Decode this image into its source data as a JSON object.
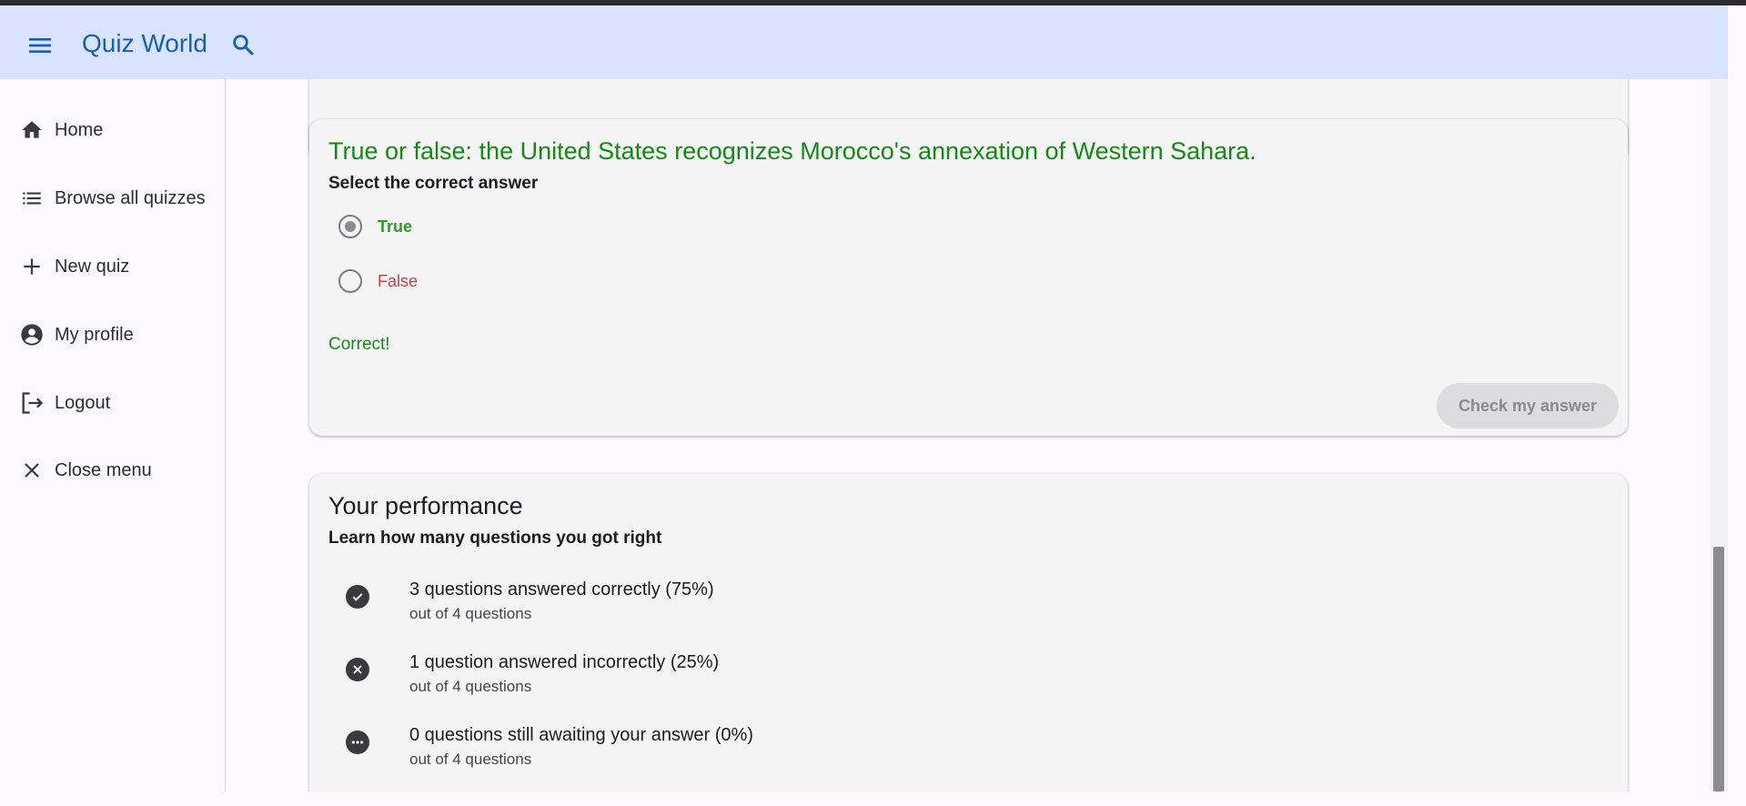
{
  "app": {
    "title": "Quiz World"
  },
  "sidebar": {
    "items": [
      {
        "label": "Home",
        "icon": "home-icon"
      },
      {
        "label": "Browse all quizzes",
        "icon": "list-icon"
      },
      {
        "label": "New quiz",
        "icon": "plus-icon"
      },
      {
        "label": "My profile",
        "icon": "account-circle-icon"
      },
      {
        "label": "Logout",
        "icon": "logout-icon"
      },
      {
        "label": "Close menu",
        "icon": "close-icon"
      }
    ]
  },
  "question": {
    "title": "True or false: the United States recognizes Morocco's annexation of Western Sahara.",
    "subtitle": "Select the correct answer",
    "options": [
      {
        "label": "True",
        "selected": true,
        "color": "#2e9a2e"
      },
      {
        "label": "False",
        "selected": false,
        "color": "#c94040"
      }
    ],
    "feedback": "Correct!",
    "check_button": "Check my answer"
  },
  "performance": {
    "title": "Your performance",
    "subtitle": "Learn how many questions you got right",
    "stats": [
      {
        "icon": "check-circle-icon",
        "text": "3 questions answered correctly (75%)",
        "sub": "out of 4 questions"
      },
      {
        "icon": "cancel-circle-icon",
        "text": "1 question answered incorrectly (25%)",
        "sub": "out of 4 questions"
      },
      {
        "icon": "more-circle-icon",
        "text": "0 questions still awaiting your answer (0%)",
        "sub": "out of 4 questions"
      }
    ]
  },
  "colors": {
    "appbar": "#d7e3ff",
    "title_blue": "#1a5fb4",
    "correct_green": "#138a13",
    "incorrect_red": "#c94040"
  }
}
